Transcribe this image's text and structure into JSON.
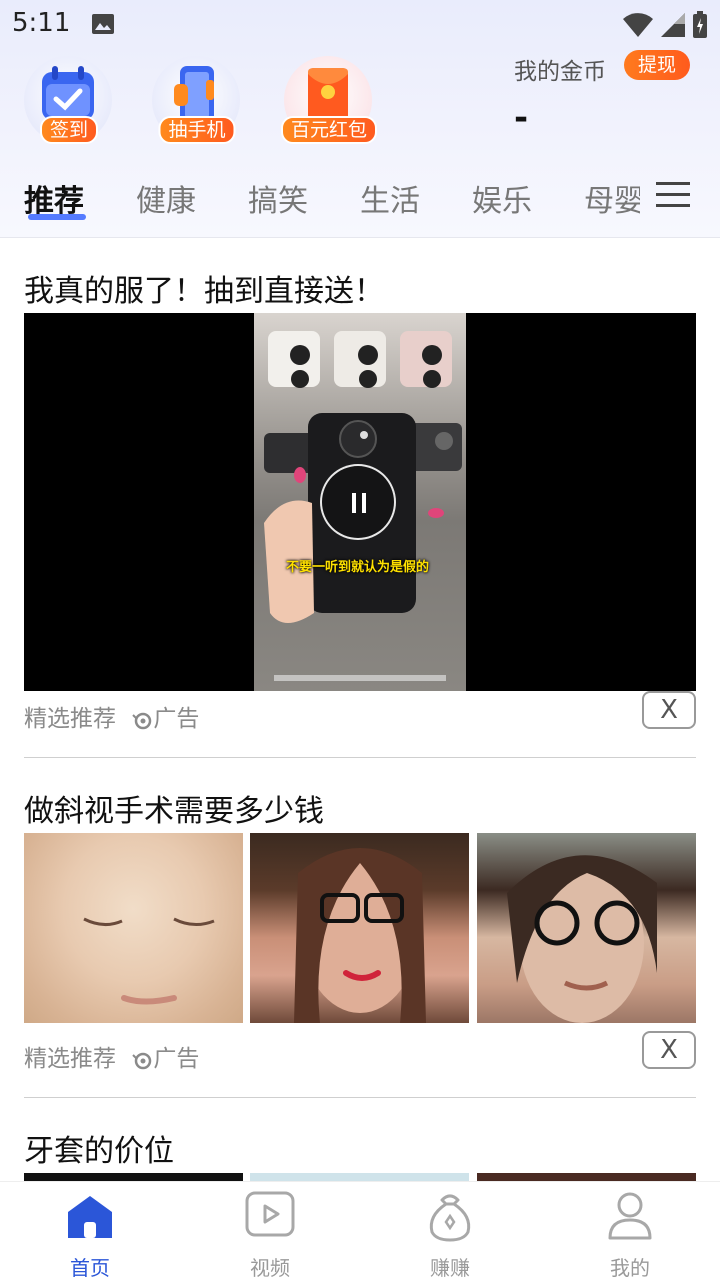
{
  "status_bar": {
    "time": "5:11"
  },
  "quick_actions": [
    {
      "label": "签到",
      "icon": "calendar-check-icon"
    },
    {
      "label": "抽手机",
      "icon": "phone-icon"
    },
    {
      "label": "百元红包",
      "icon": "red-envelope-icon"
    }
  ],
  "coins": {
    "label": "我的金币",
    "withdraw_label": "提现",
    "value": "-"
  },
  "tabs": [
    "推荐",
    "健康",
    "搞笑",
    "生活",
    "娱乐",
    "母婴"
  ],
  "feed": {
    "card1": {
      "title": "我真的服了！抽到直接送！",
      "video_caption": "不要一听到就认为是假的",
      "source": "精选推荐",
      "ad_label": "广告",
      "close_label": "X"
    },
    "card2": {
      "title": "做斜视手术需要多少钱",
      "source": "精选推荐",
      "ad_label": "广告",
      "close_label": "X"
    },
    "card3": {
      "title": "牙套的价位"
    }
  },
  "bottom_nav": [
    {
      "label": "首页",
      "icon": "home-icon",
      "active": true
    },
    {
      "label": "视频",
      "icon": "video-play-icon",
      "active": false
    },
    {
      "label": "赚赚",
      "icon": "money-bag-icon",
      "active": false
    },
    {
      "label": "我的",
      "icon": "user-icon",
      "active": false
    }
  ],
  "colors": {
    "accent_blue": "#2b56d8",
    "orange": "#ff5b1d"
  }
}
